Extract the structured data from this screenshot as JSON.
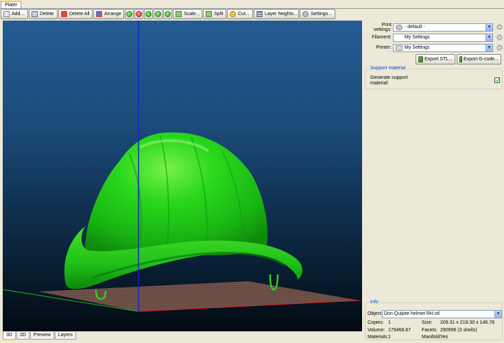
{
  "window": {
    "tab": "Plater"
  },
  "toolbar": {
    "add": "Add...",
    "delete": "Delete",
    "delete_all": "Delete All",
    "arrange": "Arrange",
    "scale": "Scale...",
    "split": "Split",
    "cut": "Cut...",
    "layer_heights": "Layer heights...",
    "settings": "Settings..."
  },
  "viewport": {
    "model_color": "#1fd31f",
    "bed_color": "#7a5a52"
  },
  "bottom_tabs": [
    "3D",
    "2D",
    "Preview",
    "Layers"
  ],
  "right_panel": {
    "print_settings_label": "Print settings:",
    "print_settings_value": "- default -",
    "filament_label": "Filament:",
    "filament_value": "My Settings",
    "printer_label": "Printer:",
    "printer_value": "My Settings",
    "export_stl": "Export STL...",
    "export_gcode": "Export G-code..."
  },
  "support": {
    "title": "Support material",
    "generate_label": "Generate support material:",
    "generate_checked": true
  },
  "info": {
    "title": "Info",
    "object_label": "Object:",
    "object_value": "Don Quijote helmet RH.stl",
    "copies_label": "Copies:",
    "copies_value": "1",
    "size_label": "Size:",
    "size_value": "209.31 x 219.30 x 146.78",
    "volume_label": "Volume:",
    "volume_value": "179468.67",
    "facets_label": "Facets:",
    "facets_value": "290996 (3 shells)",
    "materials_label": "Materials:",
    "materials_value": "1",
    "manifold_label": "Manifold:",
    "manifold_value": "Yes"
  }
}
